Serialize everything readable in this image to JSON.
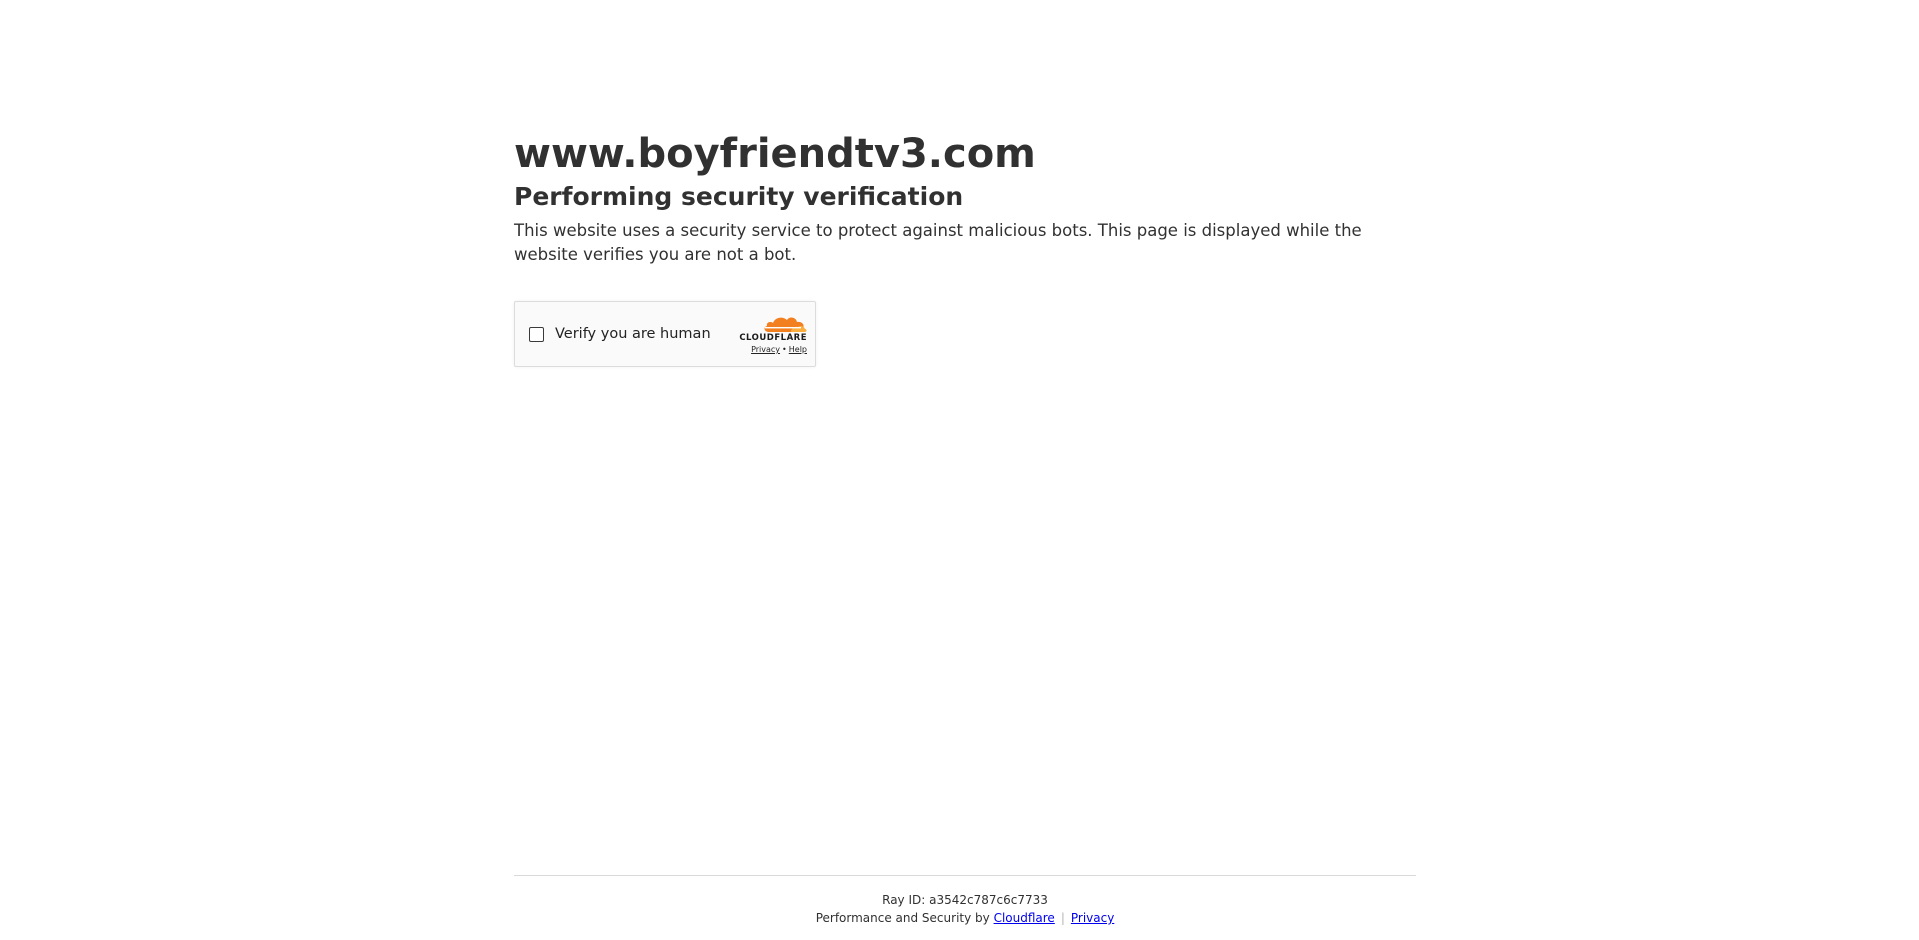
{
  "header": {
    "site_title": "www.boyfriendtv3.com",
    "subtitle": "Performing security verification",
    "description": "This website uses a security service to protect against malicious bots. This page is displayed while the website verifies you are not a bot."
  },
  "widget": {
    "checkbox_label": "Verify you are human",
    "brand_word": "CLOUDFLARE",
    "privacy_label": "Privacy",
    "separator": "•",
    "help_label": "Help",
    "icon": "cloudflare-cloud-icon",
    "brand_color": "#f38020"
  },
  "footer": {
    "ray_label": "Ray ID: ",
    "ray_id": "a3542c787c6c7733",
    "perf_label": "Performance and Security by ",
    "cloudflare_link": "Cloudflare",
    "separator": "|",
    "privacy_link": "Privacy"
  }
}
